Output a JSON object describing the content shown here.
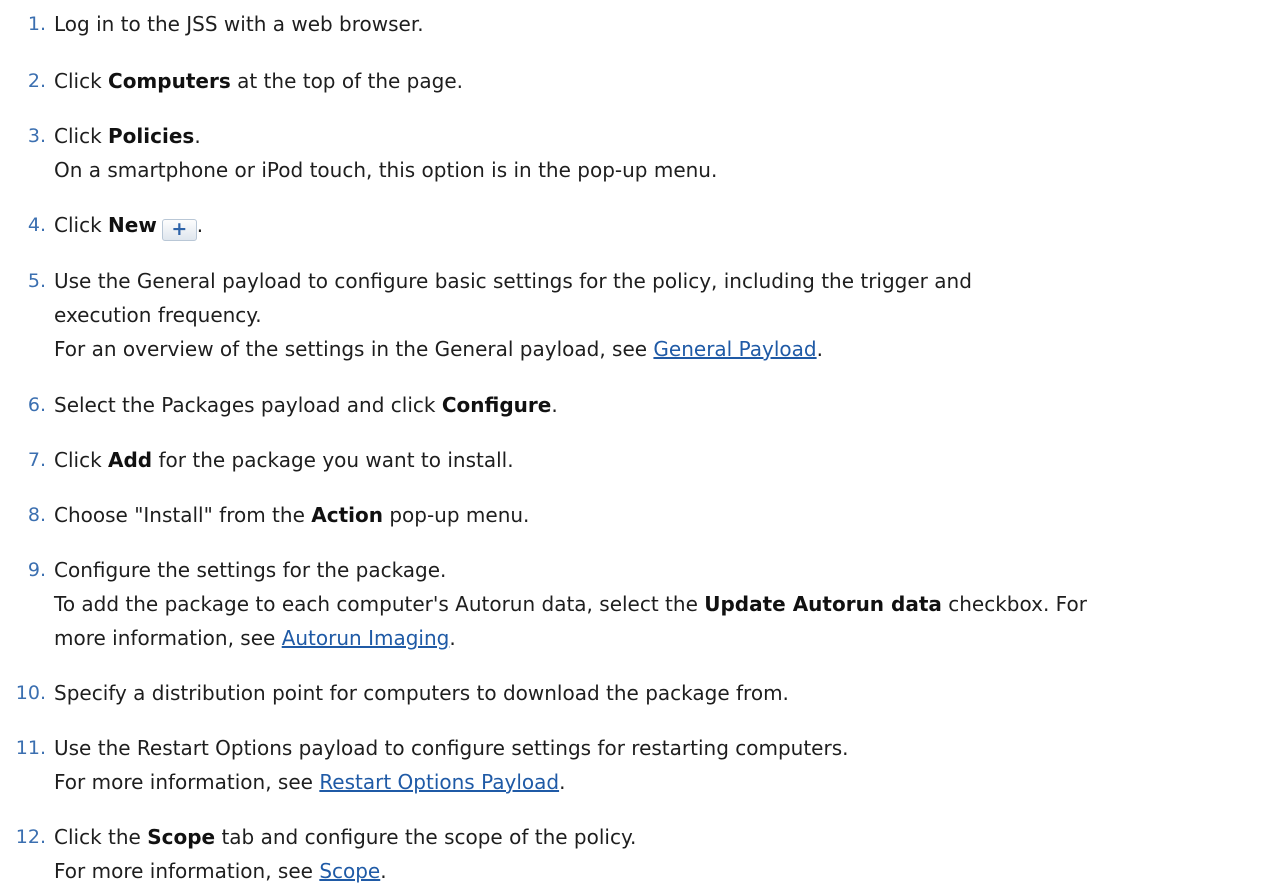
{
  "steps": [
    {
      "num": "1.",
      "pre": "Log in to the JSS with a web browser."
    },
    {
      "num": "2.",
      "pre": "Click ",
      "bold": "Computers",
      "post": " at the top of the page."
    },
    {
      "num": "3.",
      "pre": "Click ",
      "bold": "Policies",
      "post": ".",
      "note": "On a smartphone or iPod touch, this option is in the pop-up menu."
    },
    {
      "num": "4.",
      "pre": "Click ",
      "bold": "New",
      "button": "+",
      "post": "."
    },
    {
      "num": "5.",
      "line1": "Use the General payload to configure basic settings for the policy, including the trigger and",
      "line2": "execution frequency.",
      "note_pre": "For an overview of the settings in the General payload, see ",
      "link": "General Payload",
      "note_post": "."
    },
    {
      "num": "6.",
      "pre": "Select the Packages payload and click ",
      "bold": "Configure",
      "post": "."
    },
    {
      "num": "7.",
      "pre": "Click ",
      "bold": "Add",
      "post": " for the package you want to install."
    },
    {
      "num": "8.",
      "pre": "Choose \"Install\" from the ",
      "bold": "Action",
      "post": " pop-up menu."
    },
    {
      "num": "9.",
      "pre": "Configure the settings for the package.",
      "note_pre": "To add the package to each computer's Autorun data, select the ",
      "note_bold": "Update Autorun data",
      "note_post": " checkbox. For",
      "note2_pre": "more information, see ",
      "link": "Autorun Imaging",
      "note2_post": "."
    },
    {
      "num": "10.",
      "pre": "Specify a distribution point for computers to download the package from."
    },
    {
      "num": "11.",
      "pre": "Use the Restart Options payload to configure settings for restarting computers.",
      "note_pre": "For more information, see ",
      "link": "Restart Options Payload",
      "note_post": "."
    },
    {
      "num": "12.",
      "pre": "Click the ",
      "bold": "Scope",
      "post": " tab and configure the scope of the policy.",
      "note_pre": "For more information, see ",
      "link": "Scope",
      "note_post": "."
    }
  ]
}
